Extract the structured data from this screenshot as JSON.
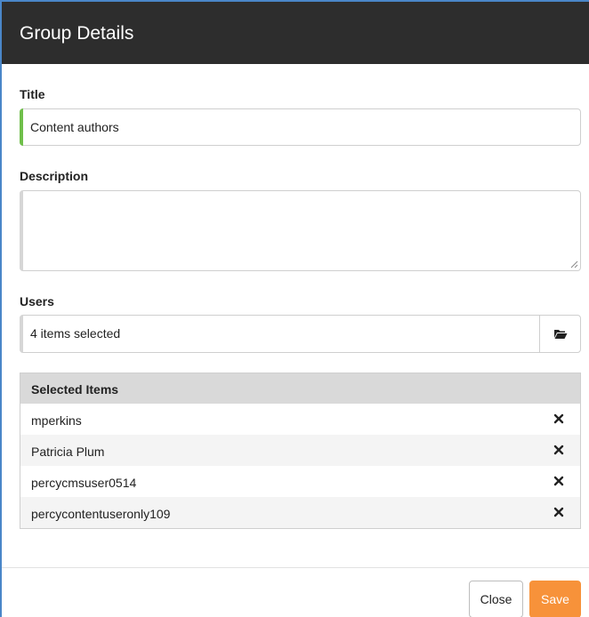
{
  "dialog": {
    "title": "Group Details"
  },
  "form": {
    "title_label": "Title",
    "title_value": "Content authors",
    "description_label": "Description",
    "description_value": "",
    "users_label": "Users",
    "users_value": "4 items selected"
  },
  "selected": {
    "header": "Selected Items",
    "items": [
      {
        "label": "mperkins"
      },
      {
        "label": "Patricia Plum"
      },
      {
        "label": "percycmsuser0514"
      },
      {
        "label": "percycontentuseronly109"
      }
    ]
  },
  "footer": {
    "close_label": "Close",
    "save_label": "Save"
  },
  "colors": {
    "header_bg": "#2d2d2d",
    "title_accent": "#6fbf4a",
    "neutral_accent": "#cfcfcf",
    "save_bg": "#f7923a",
    "frame": "#4a86c8"
  },
  "icons": {
    "users_picker": "folder-open-icon",
    "remove": "close-icon",
    "resize": "resize-handle-icon"
  }
}
